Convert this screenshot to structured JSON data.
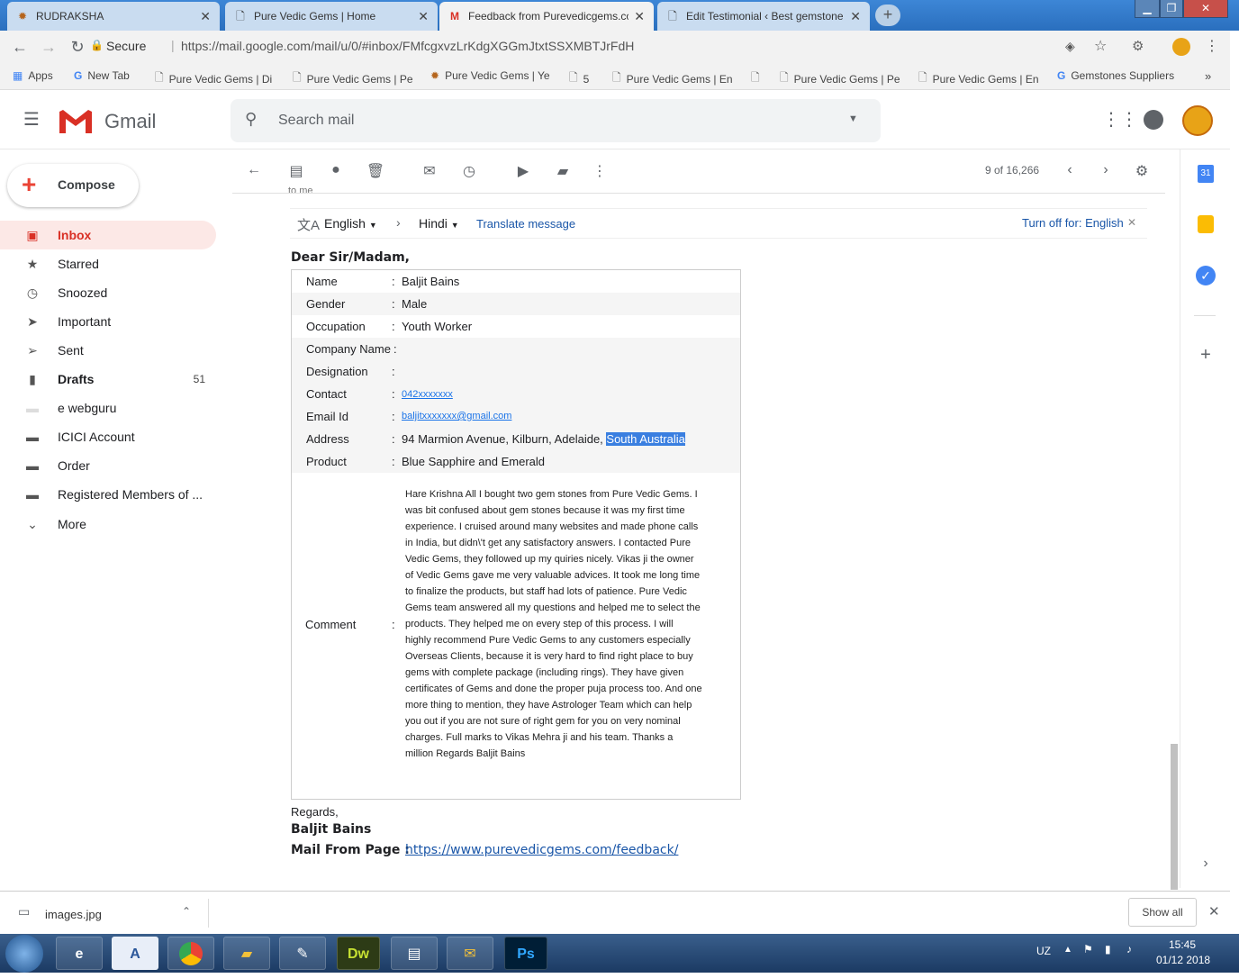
{
  "browser": {
    "tabs": [
      {
        "title": "RUDRAKSHA",
        "icon": "rudraksha-favicon"
      },
      {
        "title": "Pure Vedic Gems | Home",
        "icon": "page-icon"
      },
      {
        "title": "Feedback from Purevedicgems.co",
        "icon": "gmail-icon"
      },
      {
        "title": "Edit Testimonial ‹ Best gemstone",
        "icon": "page-icon"
      }
    ],
    "secure_label": "Secure",
    "url": "https://mail.google.com/mail/u/0/#inbox/FMfcgxvzLrKdgXGGmJtxtSSXMBTJrFdH",
    "bookmarks": [
      "Apps",
      "New Tab",
      "Pure Vedic Gems | Di",
      "Pure Vedic Gems | Pe",
      "Pure Vedic Gems | Ye",
      "5",
      "Pure Vedic Gems | En",
      "Pure Vedic Gems | Pe",
      "Pure Vedic Gems | En",
      "Gemstones Suppliers"
    ]
  },
  "gmail": {
    "logo_text": "Gmail",
    "search_placeholder": "Search mail",
    "compose_label": "Compose",
    "nav": [
      {
        "label": "Inbox",
        "count": "",
        "icon": "inbox-icon"
      },
      {
        "label": "Starred",
        "count": "",
        "icon": "star-icon"
      },
      {
        "label": "Snoozed",
        "count": "",
        "icon": "clock-icon"
      },
      {
        "label": "Important",
        "count": "",
        "icon": "important-icon"
      },
      {
        "label": "Sent",
        "count": "",
        "icon": "send-icon"
      },
      {
        "label": "Drafts",
        "count": "51",
        "icon": "draft-icon"
      },
      {
        "label": "e webguru",
        "count": "",
        "icon": "label-icon"
      },
      {
        "label": "ICICI Account",
        "count": "",
        "icon": "label-icon"
      },
      {
        "label": "Order",
        "count": "",
        "icon": "label-icon"
      },
      {
        "label": "Registered Members of ...",
        "count": "",
        "icon": "label-icon"
      },
      {
        "label": "More",
        "count": "",
        "icon": "chevron-down-icon"
      }
    ],
    "pagination": "9 of 16,266",
    "to_me": "to me"
  },
  "translate": {
    "from_lang": "English",
    "to_lang": "Hindi",
    "translate_link": "Translate message",
    "turn_off": "Turn off for: English"
  },
  "email": {
    "greeting": "Dear Sir/Madam,",
    "rows": [
      {
        "label": "Name",
        "value": "Baljit Bains"
      },
      {
        "label": "Gender",
        "value": "Male"
      },
      {
        "label": "Occupation",
        "value": "Youth Worker"
      },
      {
        "label": "Company Name",
        "value": ""
      },
      {
        "label": "Designation",
        "value": ""
      },
      {
        "label": "Contact",
        "value": "042xxxxxxx"
      },
      {
        "label": "Email Id",
        "value": "baljitxxxxxxx@gmail.com"
      },
      {
        "label": "Address",
        "value": "94 Marmion Avenue, Kilburn, Adelaide, ",
        "highlight": "South Australia"
      },
      {
        "label": "Product",
        "value": "Blue Sapphire and Emerald"
      }
    ],
    "comment_label": "Comment",
    "comment_lines": [
      "Hare Krishna All I bought two gem stones from Pure Vedic Gems. I",
      "was bit confused about gem stones because it was my first time",
      "experience. I cruised around many websites and made phone calls",
      "in India, but didn\\'t get any satisfactory answers. I contacted Pure",
      "Vedic Gems, they followed up my quiries nicely. Vikas ji the owner",
      "of Vedic Gems gave me very valuable advices. It took me long time",
      "to finalize the products, but staff had lots of patience. Pure Vedic",
      "Gems team answered all my questions and helped me to select the",
      "products. They helped me on every step of this process. I will",
      "highly recommend Pure Vedic Gems to any customers especially",
      "Overseas Clients, because it is very hard to find right place to buy",
      "gems with complete package (including rings). They have given",
      "certificates of Gems and done the proper puja process too. And one",
      "more thing to mention, they have Astrologer Team which can help",
      "you out if you are not sure of right gem for you on very nominal",
      "charges. Full marks to Vikas Mehra ji and his team. Thanks a",
      "million Regards Baljit Bains"
    ],
    "regards": "Regards,",
    "signature": "Baljit Bains",
    "mail_from_label": "Mail From Page :",
    "mail_from_url": "https://www.purevedicgems.com/feedback/"
  },
  "downloads": {
    "file": "images.jpg",
    "show_all": "Show all"
  },
  "taskbar": {
    "lang": "UZ",
    "time": "15:45",
    "date": "01/12 2018",
    "apps": [
      "ie-icon",
      "word-icon",
      "chrome-icon",
      "explorer-icon",
      "paint-icon",
      "Dw",
      "network-icon",
      "mail-icon",
      "Ps"
    ]
  }
}
